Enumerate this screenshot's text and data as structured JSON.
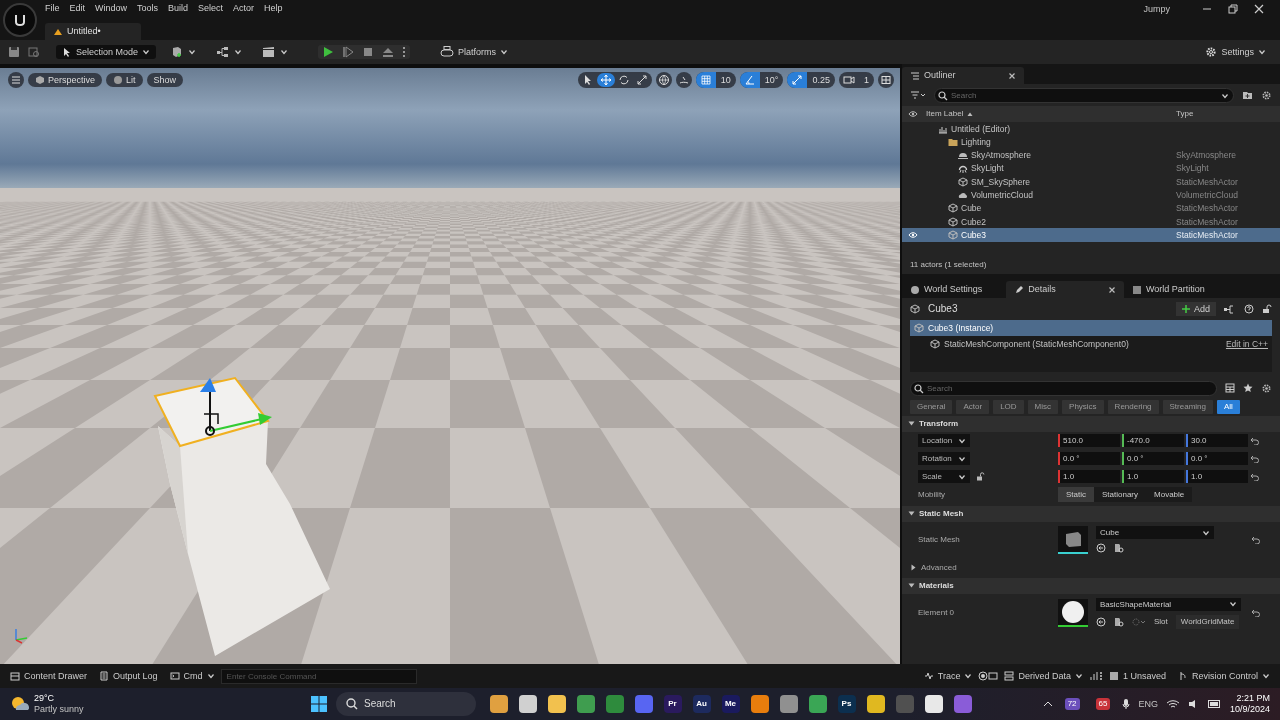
{
  "title_bar": {
    "menu": [
      "File",
      "Edit",
      "Window",
      "Tools",
      "Build",
      "Select",
      "Actor",
      "Help"
    ],
    "project": "Jumpy",
    "document_tab": "Untitled•"
  },
  "main_toolbar": {
    "mode": "Selection Mode",
    "platforms": "Platforms",
    "settings": "Settings"
  },
  "viewport": {
    "view_buttons": [
      "Perspective",
      "Lit",
      "Show"
    ],
    "transform_tools": [
      {
        "kind": "select",
        "selected": false
      },
      {
        "kind": "move",
        "selected": true
      },
      {
        "kind": "rotate",
        "selected": false
      },
      {
        "kind": "scale",
        "selected": false
      }
    ],
    "snaps": [
      {
        "kind": "grid",
        "value": "10",
        "on": true
      },
      {
        "kind": "angle",
        "value": "10°",
        "on": true
      },
      {
        "kind": "scale",
        "value": "0.25",
        "on": true
      },
      {
        "kind": "camera",
        "value": "1",
        "on": false
      }
    ]
  },
  "outliner": {
    "title": "Outliner",
    "search": {
      "placeholder": "Search"
    },
    "columns": [
      "Item Label",
      "Type"
    ],
    "tree": [
      {
        "label": "Untitled (Editor)",
        "kind": "world",
        "selected": false,
        "children": [
          {
            "label": "Lighting",
            "kind": "folder",
            "selected": false,
            "children": [
              {
                "label": "SkyAtmosphere",
                "kind": "atmosphere",
                "type": "SkyAtmosphere",
                "selected": false
              },
              {
                "label": "SkyLight",
                "kind": "light",
                "type": "SkyLight",
                "selected": false
              },
              {
                "label": "SM_SkySphere",
                "kind": "mesh",
                "type": "StaticMeshActor",
                "selected": false
              },
              {
                "label": "VolumetricCloud",
                "kind": "cloud",
                "type": "VolumetricCloud",
                "selected": false
              }
            ]
          },
          {
            "label": "Cube",
            "kind": "mesh",
            "type": "StaticMeshActor",
            "selected": false
          },
          {
            "label": "Cube2",
            "kind": "mesh",
            "type": "StaticMeshActor",
            "selected": false
          },
          {
            "label": "Cube3",
            "kind": "mesh",
            "type": "StaticMeshActor",
            "selected": true
          }
        ]
      }
    ],
    "status": "11 actors (1 selected)"
  },
  "details": {
    "tabs": [
      {
        "label": "World Settings",
        "kind": "globe",
        "selected": false
      },
      {
        "label": "Details",
        "kind": "pencil",
        "selected": true
      },
      {
        "label": "World Partition",
        "kind": "grid",
        "selected": false
      }
    ],
    "actor_name": "Cube3",
    "add_button": "Add",
    "components": [
      {
        "label": "Cube3 (Instance)",
        "selected": true
      },
      {
        "label": "StaticMeshComponent (StaticMeshComponent0)",
        "selected": false
      }
    ],
    "edit_link": "Edit in C++",
    "search": {
      "placeholder": "Search"
    },
    "filters": [
      {
        "label": "General",
        "selected": false
      },
      {
        "label": "Actor",
        "selected": false
      },
      {
        "label": "LOD",
        "selected": false
      },
      {
        "label": "Misc",
        "selected": false
      },
      {
        "label": "Physics",
        "selected": false
      },
      {
        "label": "Rendering",
        "selected": false
      },
      {
        "label": "Streaming",
        "selected": false
      },
      {
        "label": "All",
        "selected": true
      }
    ],
    "sections": [
      {
        "title": "Transform",
        "kind": "transform",
        "expanded": true,
        "rows": [
          {
            "label": "Location",
            "values": [
              "510.0",
              "-470.0",
              "30.0"
            ]
          },
          {
            "label": "Rotation",
            "values": [
              "0.0 °",
              "0.0 °",
              "0.0 °"
            ]
          },
          {
            "label": "Scale",
            "values": [
              "1.0",
              "1.0",
              "1.0"
            ]
          }
        ],
        "mobility": {
          "label": "Mobility",
          "options": [
            {
              "label": "Static",
              "selected": true
            },
            {
              "label": "Stationary",
              "selected": false
            },
            {
              "label": "Movable",
              "selected": false
            }
          ]
        }
      },
      {
        "title": "Static Mesh",
        "kind": "mesh",
        "expanded": true,
        "label": "Static Mesh",
        "asset": "Cube"
      },
      {
        "title": "Advanced",
        "kind": "sub",
        "expanded": false
      },
      {
        "title": "Materials",
        "kind": "material",
        "expanded": true,
        "label": "Element 0",
        "asset": "BasicShapeMaterial",
        "slot_label": "Slot",
        "slot": "WorldGridMate"
      }
    ]
  },
  "status_bar": {
    "left": [
      {
        "kind": "drawer",
        "label": "Content Drawer"
      },
      {
        "kind": "log",
        "label": "Output Log"
      },
      {
        "kind": "cmd",
        "label": "Cmd"
      }
    ],
    "console": {
      "placeholder": "Enter Console Command"
    },
    "right": [
      {
        "kind": "trace",
        "label": "Trace"
      },
      {
        "kind": "ddc",
        "label": "Derived Data"
      },
      {
        "kind": "unsaved",
        "label": "1 Unsaved"
      },
      {
        "kind": "revision",
        "label": "Revision Control"
      }
    ]
  },
  "taskbar": {
    "weather": {
      "temp": "29°C",
      "desc": "Partly sunny"
    },
    "search": "Search",
    "apps": [
      {
        "color": "#e0a040"
      },
      {
        "color": "#d0d0d0"
      },
      {
        "color": "#f2c14e"
      },
      {
        "color": "#3f9d4f"
      },
      {
        "color": "#2e8b3d"
      },
      {
        "color": "#5865f2"
      },
      {
        "label": "Pr",
        "color": "#2a1a5e"
      },
      {
        "label": "Au",
        "color": "#1d2a5e"
      },
      {
        "label": "Me",
        "color": "#1a1a5e"
      },
      {
        "color": "#e87d0d"
      },
      {
        "color": "#909090"
      },
      {
        "color": "#3aa655"
      },
      {
        "label": "Ps",
        "color": "#0c2f4f"
      },
      {
        "color": "#e0b820"
      },
      {
        "color": "#505050"
      },
      {
        "color": "#e8e8e8"
      },
      {
        "color": "#8a5cd8"
      }
    ],
    "badges": [
      {
        "label": "72",
        "color": "#6b4fbb"
      },
      {
        "label": "65",
        "color": "#c8333a"
      }
    ],
    "language": "ENG",
    "time": "2:21 PM",
    "date": "10/9/2024"
  }
}
